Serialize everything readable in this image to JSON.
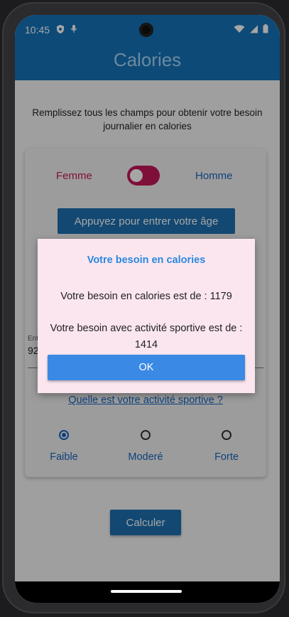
{
  "status_bar": {
    "time": "10:45",
    "left_icons": [
      "shield-icon",
      "microphone-icon"
    ],
    "right_icons": [
      "wifi-icon",
      "signal-icon",
      "battery-icon"
    ]
  },
  "app_bar": {
    "title": "Calories"
  },
  "form": {
    "instruction": "Remplissez tous les champs pour obtenir votre besoin journalier en calories",
    "gender": {
      "female_label": "Femme",
      "male_label": "Homme",
      "switch_on": true
    },
    "age_button_label": "Appuyez pour entrer votre âge",
    "weight": {
      "label": "Ent",
      "value": "92"
    },
    "activity_question": "Quelle est votre activité sportive ?",
    "activity_options": [
      {
        "label": "Faible",
        "checked": true
      },
      {
        "label": "Moderé",
        "checked": false
      },
      {
        "label": "Forte",
        "checked": false
      }
    ],
    "calculate_button_label": "Calculer"
  },
  "dialog": {
    "title": "Votre besoin en calories",
    "line1": "Votre besoin en calories est de : 1179",
    "line2": "Votre besoin avec activité sportive est de : 1414",
    "ok_label": "OK"
  },
  "colors": {
    "primary": "#1572b7",
    "female": "#c2185b",
    "male": "#1565c0",
    "dialog_background": "#fbe6f0",
    "dialog_accent": "#3a89e4"
  }
}
